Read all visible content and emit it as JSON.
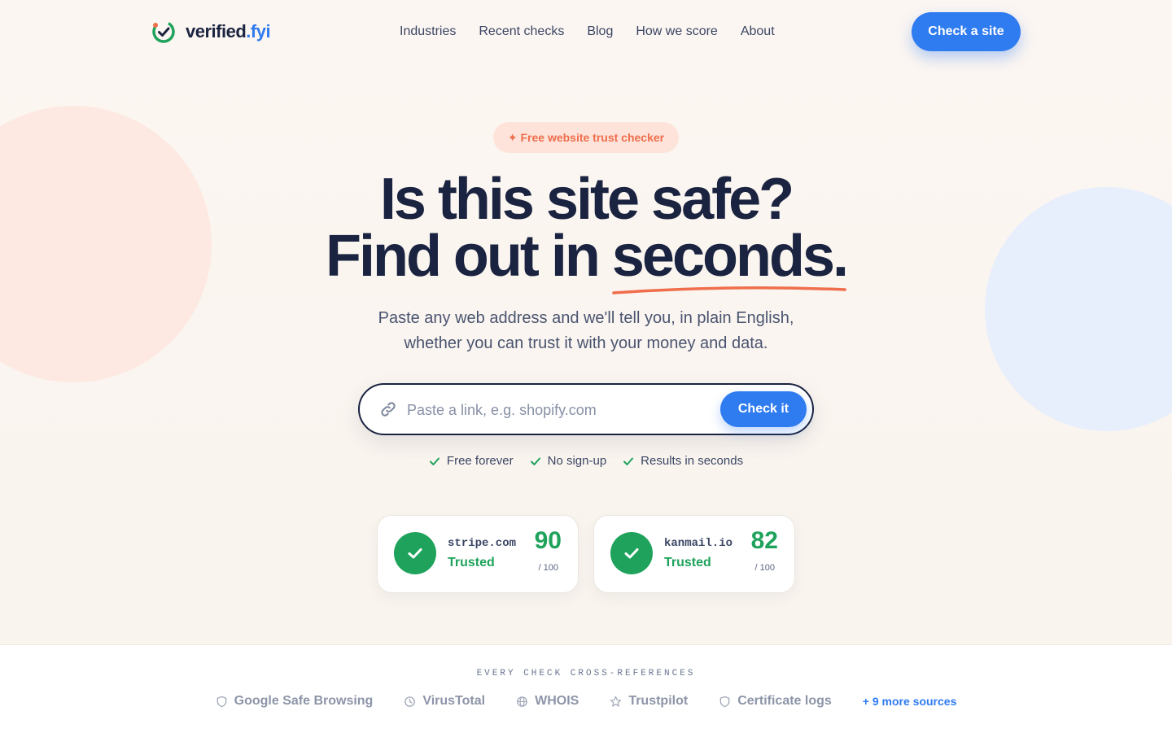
{
  "brand": {
    "name": "verified",
    "suffix": ".fyi"
  },
  "nav": {
    "links": [
      {
        "label": "Industries"
      },
      {
        "label": "Recent checks"
      },
      {
        "label": "Blog"
      },
      {
        "label": "How we score"
      },
      {
        "label": "About"
      }
    ],
    "cta_label": "Check a site"
  },
  "hero": {
    "badge": "✦ Free website trust checker",
    "headline_line1": "Is this site safe?",
    "headline_line2_prefix": "Find out in ",
    "headline_line2_highlight": "seconds",
    "headline_line2_suffix": ".",
    "subhead_line1": "Paste any web address and we'll tell you, in plain English,",
    "subhead_line2": "whether you can trust it with your money and data.",
    "search": {
      "placeholder": "Paste a link, e.g. shopify.com",
      "value": "",
      "button_label": "Check it"
    },
    "perks": [
      "Free forever",
      "No sign-up",
      "Results in seconds"
    ]
  },
  "samples": [
    {
      "domain": "stripe.com",
      "status": "Trusted",
      "score": "90",
      "max": "/ 100"
    },
    {
      "domain": "kanmail.io",
      "status": "Trusted",
      "score": "82",
      "max": "/ 100"
    }
  ],
  "sources": {
    "label": "EVERY CHECK CROSS-REFERENCES",
    "items": [
      {
        "label": "Google Safe Browsing",
        "icon": "shield-icon"
      },
      {
        "label": "VirusTotal",
        "icon": "clock-icon"
      },
      {
        "label": "WHOIS",
        "icon": "globe-icon"
      },
      {
        "label": "Trustpilot",
        "icon": "star-icon"
      },
      {
        "label": "Certificate logs",
        "icon": "shield-icon"
      }
    ],
    "more_label": "+ 9 more sources"
  },
  "colors": {
    "accent": "#2f7bf0",
    "trusted": "#1fa35c",
    "highlight": "#ef6e4c",
    "ink": "#1a2340"
  }
}
